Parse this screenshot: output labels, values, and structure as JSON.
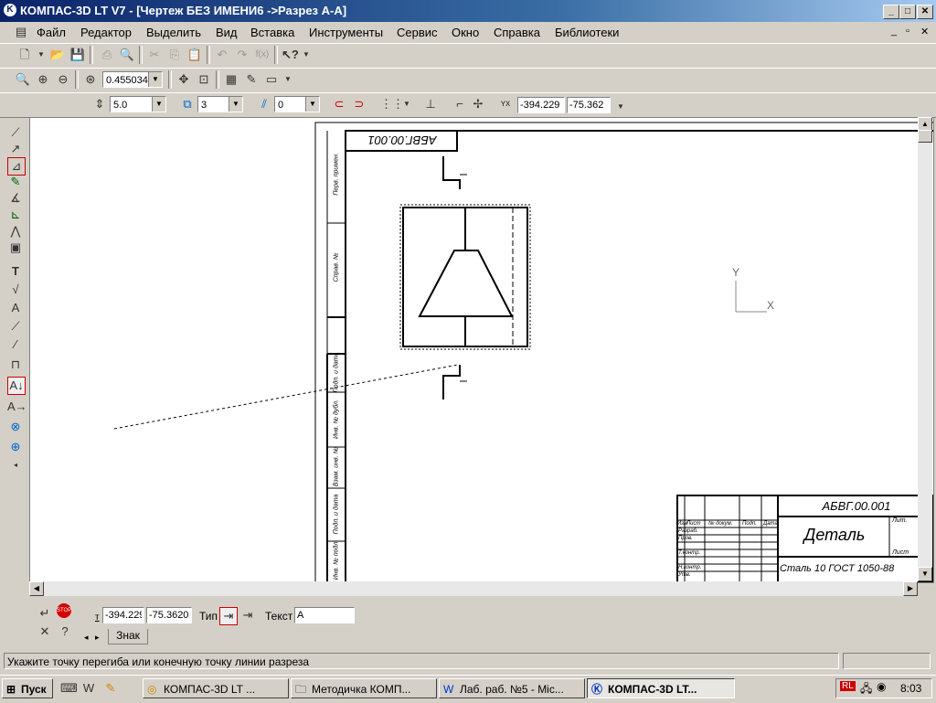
{
  "window": {
    "title": "КОМПАС-3D LT V7 - [Чертеж БЕЗ ИМЕНИ6 ->Разрез А-А]",
    "controls": [
      "_",
      "□",
      "✕"
    ]
  },
  "menubar": {
    "items": [
      "Файл",
      "Редактор",
      "Выделить",
      "Вид",
      "Вставка",
      "Инструменты",
      "Сервис",
      "Окно",
      "Справка",
      "Библиотеки"
    ],
    "doc_controls": [
      "_",
      "▫",
      "✕"
    ]
  },
  "toolbar3": {
    "zoom_value": "0.455034"
  },
  "toolbar4": {
    "step_value": "5.0",
    "layer_value": "3",
    "style_value": "0",
    "coord_x": "-394.229",
    "coord_y": "-75.362"
  },
  "drawing": {
    "stamp_top": "АБВГ.00.001",
    "part_name": "Деталь",
    "designation": "АБВГ.00.001",
    "material": "Сталь 10 ГОСТ 1050-88",
    "lit_label": "Лит.",
    "list_label": "Лист",
    "axis_y": "Y",
    "axis_x": "X",
    "table_headers": [
      "Изм",
      "Лист",
      "№ докум.",
      "Подп.",
      "Дата"
    ],
    "table_rows": [
      "Разраб.",
      "Пров.",
      "Т.контр.",
      "",
      "Н.контр.",
      "Утв."
    ],
    "side_labels": [
      "Перв. примен.",
      "Справ. №",
      "Подп. и дата",
      "Инв. № дубл.",
      "Взам. инв. №",
      "Подп. и дата",
      "Инв. № подл."
    ]
  },
  "bottom_panel": {
    "coord_x": "-394.229",
    "coord_y": "-75.3620",
    "type_label": "Тип",
    "text_label": "Текст",
    "text_value": "А",
    "tab_label": "Знак",
    "t_label": "т"
  },
  "status": {
    "message": "Укажите точку перегиба или конечную точку линии разреза"
  },
  "taskbar": {
    "start": "Пуск",
    "tasks": [
      "КОМПАС-3D LT ...",
      "Методичка КОМП...",
      "Лаб. раб. №5 - Mic...",
      "КОМПАС-3D LT..."
    ],
    "lang": "RL",
    "clock": "8:03"
  },
  "colors": {
    "title_start": "#0a246a",
    "title_end": "#a6caf0",
    "stop_red": "#d40000",
    "desktop_gray": "#d4d0c8"
  }
}
